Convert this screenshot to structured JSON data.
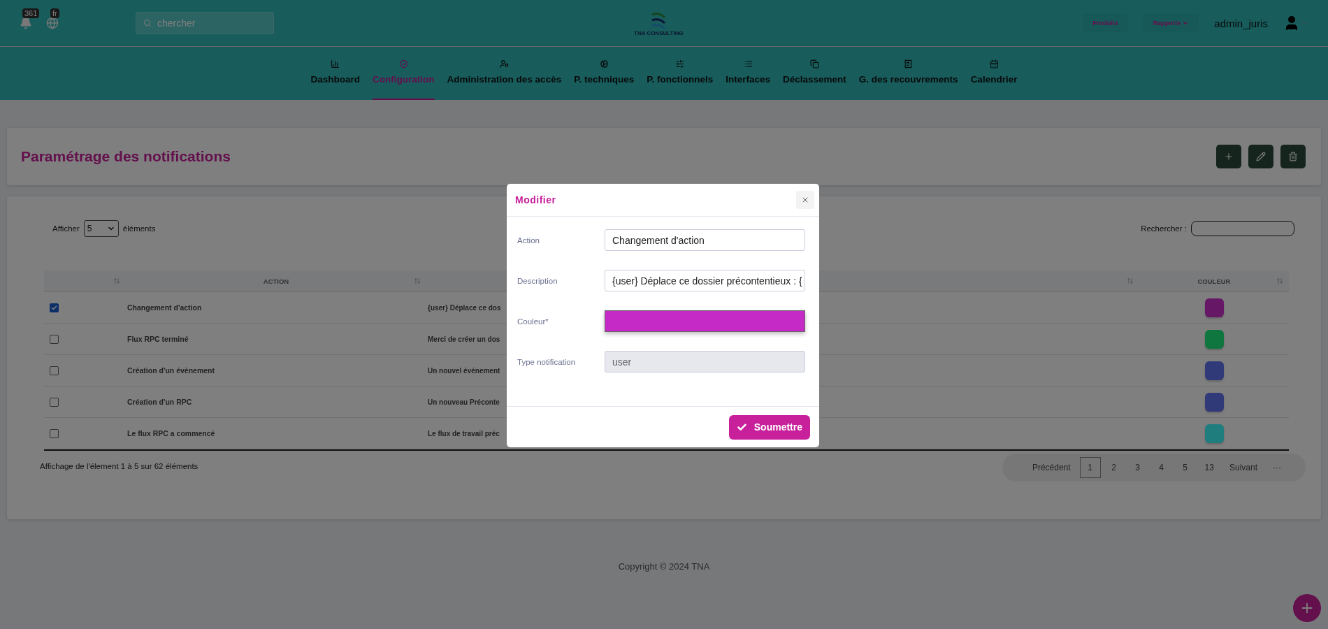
{
  "top_bar": {
    "notifications": {
      "count": "361"
    },
    "language": {
      "code": "fr"
    },
    "search": {
      "placeholder": "chercher"
    },
    "logo": {
      "text": "TNA CONSULTING"
    },
    "links": [
      {
        "label": "Produits",
        "dropdown": false
      },
      {
        "label": "Rapports",
        "dropdown": true
      }
    ],
    "user": {
      "name": "admin_juris"
    }
  },
  "nav": [
    {
      "label": "Dashboard",
      "selected": false
    },
    {
      "label": "Configuration",
      "selected": true
    },
    {
      "label": "Administration des accès",
      "selected": false
    },
    {
      "label": "P. techniques",
      "selected": false
    },
    {
      "label": "P. fonctionnels",
      "selected": false
    },
    {
      "label": "Interfaces",
      "selected": false
    },
    {
      "label": "Déclassement",
      "selected": false
    },
    {
      "label": "G. des recouvrements",
      "selected": false
    },
    {
      "label": "Calendrier",
      "selected": false
    }
  ],
  "page": {
    "title": "Paramétrage des notifications",
    "actions": [
      {
        "kind": "add"
      },
      {
        "kind": "edit"
      },
      {
        "kind": "delete"
      }
    ]
  },
  "table": {
    "length_label_before": "Afficher",
    "length_value": "5",
    "length_label_after": "éléments",
    "search_label": "Rechercher :",
    "columns": [
      {},
      {
        "label": "ACTION"
      },
      {},
      {
        "label": "COULEUR"
      }
    ],
    "rows": [
      {
        "checked": true,
        "action": "Changement d'action",
        "description": "{user} Déplace ce dos",
        "color": "#661866"
      },
      {
        "checked": false,
        "action": "Flux RPC terminé",
        "description": "Merci de créer un dos",
        "color": "#10763f"
      },
      {
        "checked": false,
        "action": "Création d'un évènement",
        "description": "Un nouvel événement",
        "color": "#303a78"
      },
      {
        "checked": false,
        "action": "Création d'un RPC",
        "description": "Un nouveau Préconte",
        "color": "#303a78"
      },
      {
        "checked": false,
        "action": "Le flux RPC a commencé",
        "description": "Le flux de travail préc",
        "color": "#1f7d7d"
      }
    ],
    "info": "Affichage de l'élement 1 à 5 sur 62 éléments",
    "pagination": [
      {
        "label": "Précédent",
        "selected": false
      },
      {
        "label": "1",
        "selected": true
      },
      {
        "label": "2",
        "selected": false
      },
      {
        "label": "3",
        "selected": false
      },
      {
        "label": "4",
        "selected": false
      },
      {
        "label": "5",
        "selected": false
      },
      {
        "label": "13",
        "selected": false
      },
      {
        "label": "Suivant",
        "selected": false
      },
      {
        "label": "···",
        "selected": false
      }
    ]
  },
  "footer": {
    "copyright": "Copyright © 2024 TNA"
  },
  "modal": {
    "title": "Modifier",
    "fields": [
      {
        "label": "Action",
        "kind": "text",
        "value": "Changement d'action",
        "disabled": false
      },
      {
        "label": "Description",
        "kind": "text",
        "value": "{user} Déplace ce dossier précontentieux : {",
        "disabled": false
      },
      {
        "label": "Couleur*",
        "kind": "color",
        "color": "#c62ac6"
      },
      {
        "label": "Type notification",
        "kind": "text",
        "value": "user",
        "disabled": true
      }
    ],
    "submit": "Soumettre"
  }
}
